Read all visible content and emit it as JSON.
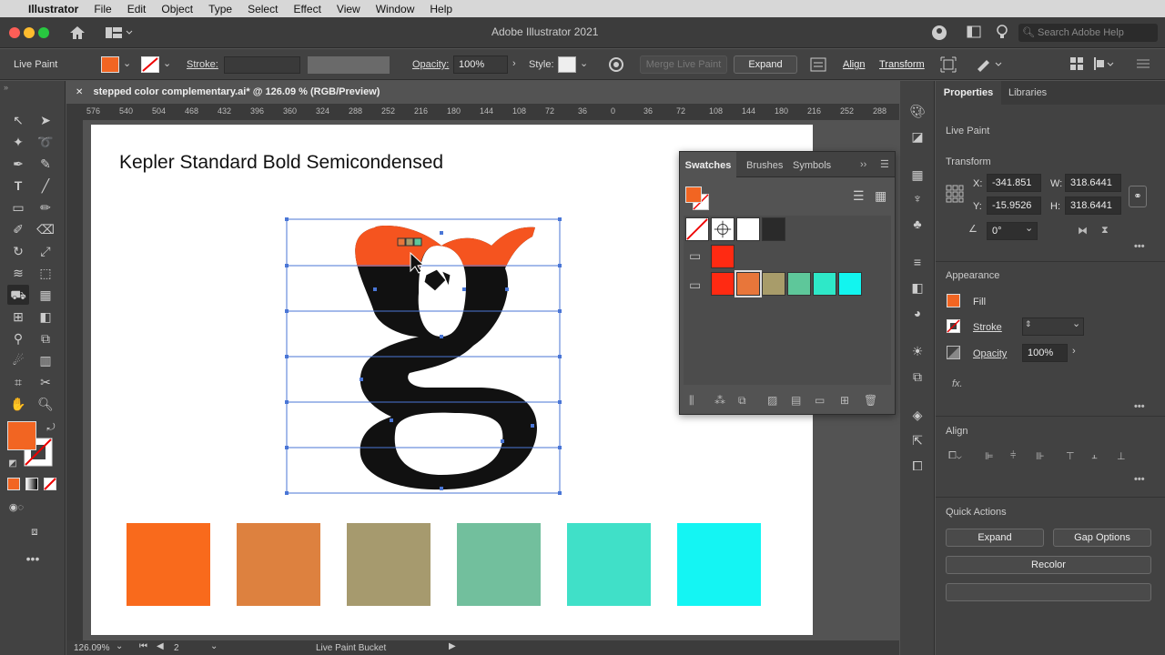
{
  "menubar": {
    "apple": "",
    "app": "Illustrator",
    "items": [
      "File",
      "Edit",
      "Object",
      "Type",
      "Select",
      "Effect",
      "View",
      "Window",
      "Help"
    ]
  },
  "titlebar": {
    "title": "Adobe Illustrator 2021",
    "search_placeholder": "Search Adobe Help"
  },
  "controlbar": {
    "mode": "Live Paint",
    "stroke_label": "Stroke:",
    "opacity_label": "Opacity:",
    "opacity_value": "100%",
    "style_label": "Style:",
    "merge_label": "Merge Live Paint",
    "expand_label": "Expand",
    "align_label": "Align",
    "transform_label": "Transform"
  },
  "document": {
    "tab": "stepped color complementary.ai* @ 126.09 % (RGB/Preview)",
    "close": "✕",
    "artboard_text": "Kepler Standard Bold Semicondensed",
    "ruler_ticks": [
      "576",
      "540",
      "504",
      "468",
      "432",
      "396",
      "360",
      "324",
      "288",
      "252",
      "216",
      "180",
      "144",
      "108",
      "72",
      "36",
      "0",
      "36",
      "72",
      "108",
      "144",
      "180",
      "216",
      "252",
      "288",
      "324"
    ]
  },
  "statusbar": {
    "zoom": "126.09%",
    "page": "2",
    "tool": "Live Paint Bucket"
  },
  "swatches_panel": {
    "tabs": [
      "Swatches",
      "Brushes",
      "Symbols"
    ]
  },
  "properties": {
    "tabs": [
      "Properties",
      "Libraries"
    ],
    "live_paint": "Live Paint",
    "transform_title": "Transform",
    "x_label": "X:",
    "x_value": "-341.851",
    "y_label": "Y:",
    "y_value": "-15.9526",
    "w_label": "W:",
    "w_value": "318.6441",
    "h_label": "H:",
    "h_value": "318.6441",
    "angle_value": "0°",
    "appearance_title": "Appearance",
    "fill_label": "Fill",
    "stroke_label": "Stroke",
    "opacity_label": "Opacity",
    "opacity_value": "100%",
    "fx": "fx.",
    "align_title": "Align",
    "quick_actions_title": "Quick Actions",
    "expand_btn": "Expand",
    "gap_btn": "Gap Options",
    "recolor_btn": "Recolor"
  },
  "colors": {
    "fill": "#f26522",
    "swatch_row": [
      "#ff2a12",
      "#e8763a",
      "#a89c6a",
      "#5ec79a",
      "#2ee8c8",
      "#12f5ef"
    ],
    "big_swatches": [
      "#f96a1c",
      "#dd813f",
      "#a69a6e",
      "#72bf9d",
      "#40e0c8",
      "#14f5f3"
    ],
    "letter_top": "#f5541f",
    "letter_body": "#111111"
  }
}
